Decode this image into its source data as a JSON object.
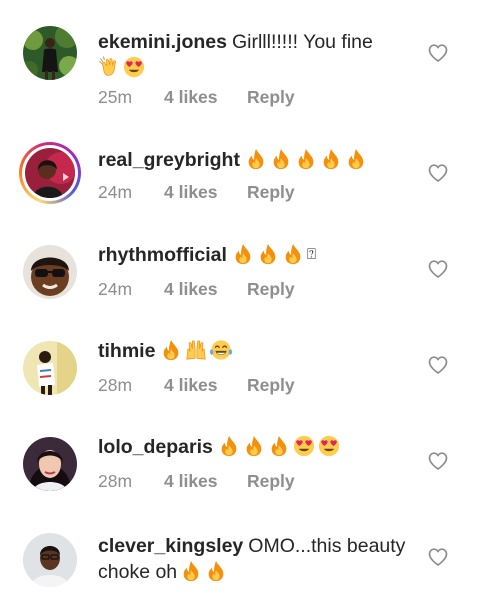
{
  "comments": [
    {
      "username": "ekemini.jones",
      "text": "Girlll!!!!! You fine",
      "line2_emojis": [
        "clapping-hands",
        "heart-eyes"
      ],
      "time": "25m",
      "likes": "4 likes",
      "reply": "Reply"
    },
    {
      "username": "real_greybright",
      "text": "",
      "emojis": [
        "fire",
        "fire",
        "fire",
        "fire",
        "fire"
      ],
      "time": "24m",
      "likes": "4 likes",
      "reply": "Reply"
    },
    {
      "username": "rhythmofficial",
      "text": "",
      "emojis": [
        "fire",
        "fire",
        "fire"
      ],
      "trailing_glyph": "⍰",
      "time": "24m",
      "likes": "4 likes",
      "reply": "Reply"
    },
    {
      "username": "tihmie",
      "text": "",
      "emojis": [
        "fire",
        "raised-hands",
        "tears-of-joy"
      ],
      "time": "28m",
      "likes": "4 likes",
      "reply": "Reply"
    },
    {
      "username": "lolo_deparis",
      "text": "",
      "emojis": [
        "fire",
        "fire",
        "fire",
        "heart-eyes",
        "heart-eyes"
      ],
      "time": "28m",
      "likes": "4 likes",
      "reply": "Reply"
    },
    {
      "username": "clever_kingsley",
      "text": "OMO...this beauty choke oh",
      "emojis": [
        "fire",
        "fire"
      ]
    }
  ],
  "colors": {
    "username": "#262626",
    "meta": "#8e8e8e",
    "heart_outline": "#8e8e8e"
  }
}
